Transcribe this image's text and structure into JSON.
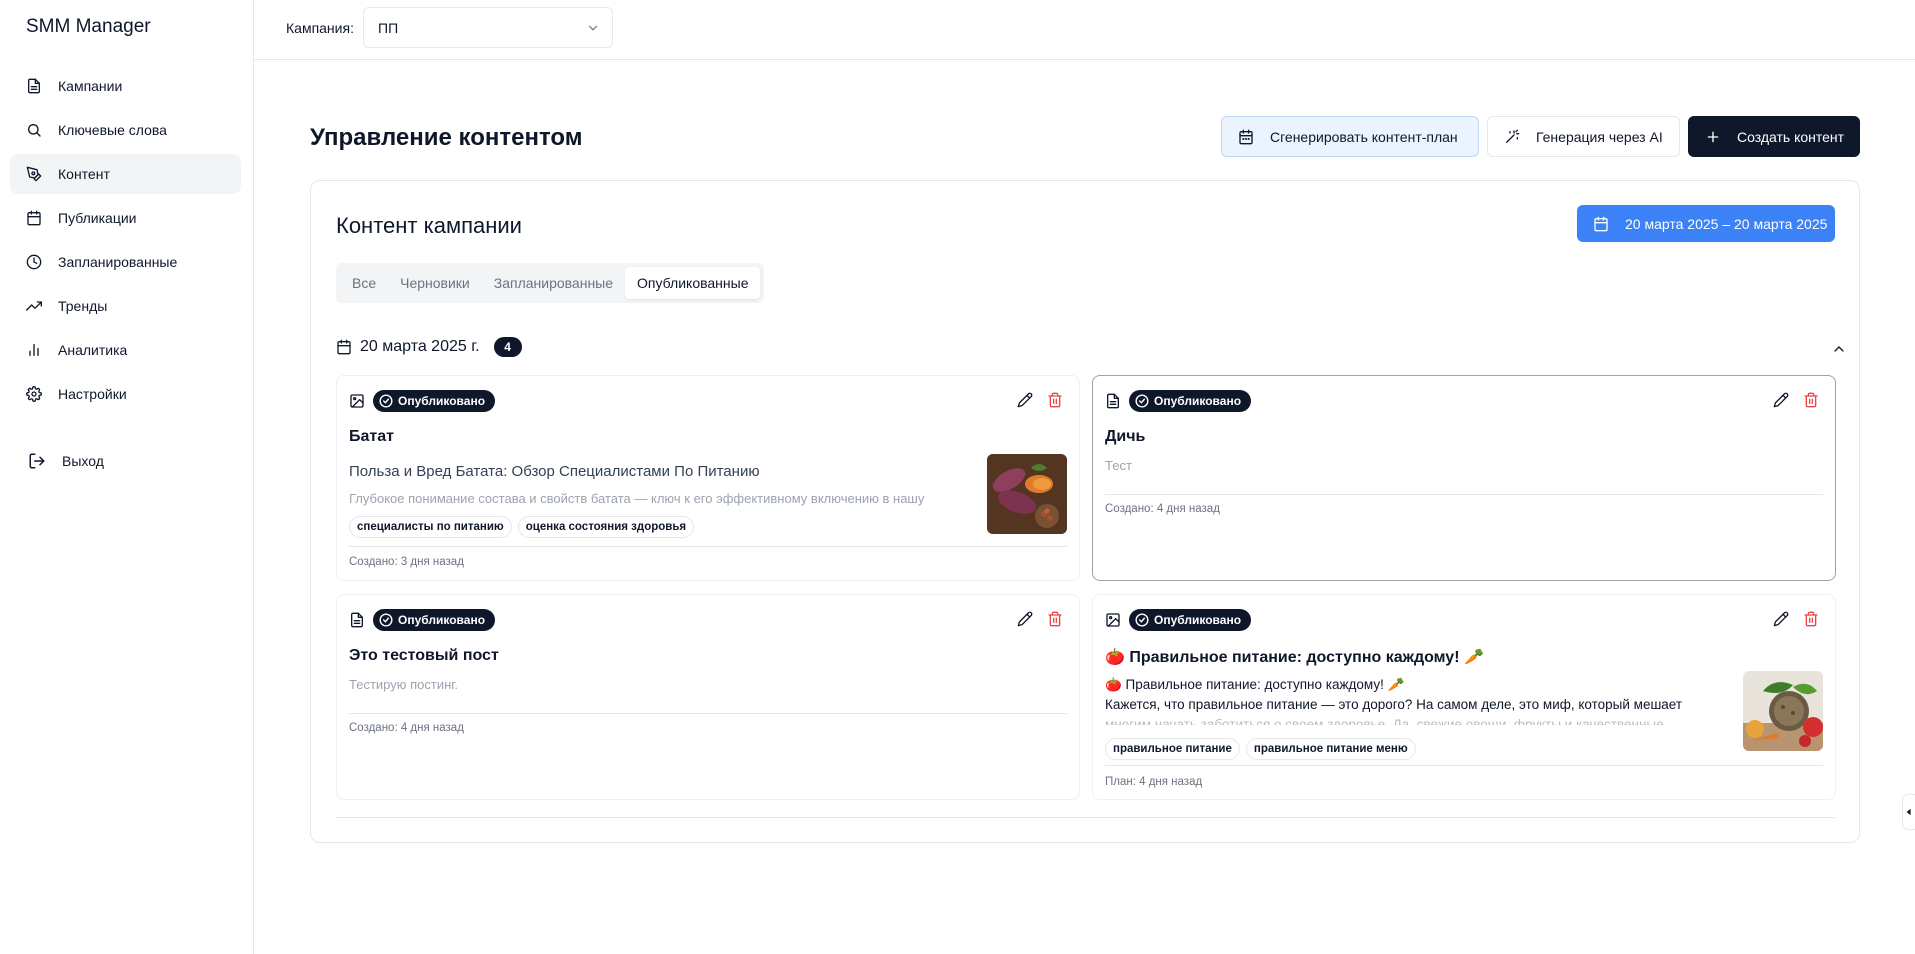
{
  "app": {
    "title": "SMM Manager"
  },
  "sidebar": {
    "items": [
      {
        "label": "Кампании",
        "icon": "file-text-icon"
      },
      {
        "label": "Ключевые слова",
        "icon": "search-icon"
      },
      {
        "label": "Контент",
        "icon": "pen-tool-icon",
        "active": true
      },
      {
        "label": "Публикации",
        "icon": "calendar-icon"
      },
      {
        "label": "Запланированные",
        "icon": "clock-icon"
      },
      {
        "label": "Тренды",
        "icon": "trending-up-icon"
      },
      {
        "label": "Аналитика",
        "icon": "bar-chart-icon"
      },
      {
        "label": "Настройки",
        "icon": "settings-icon"
      }
    ],
    "logout": "Выход"
  },
  "topbar": {
    "campaign_label": "Кампания:",
    "campaign_value": "ПП"
  },
  "header": {
    "title": "Управление контентом",
    "btn_plan": "Сгенерировать контент-план",
    "btn_ai": "Генерация через AI",
    "btn_create": "Создать контент"
  },
  "content": {
    "title": "Контент кампании",
    "date_range": "20 марта 2025 – 20 марта 2025",
    "tabs": [
      {
        "label": "Все"
      },
      {
        "label": "Черновики"
      },
      {
        "label": "Запланированные"
      },
      {
        "label": "Опубликованные",
        "active": true
      }
    ],
    "day": {
      "label": "20 марта 2025 г.",
      "count": "4"
    }
  },
  "posts": [
    {
      "type_icon": "image-icon",
      "status": "Опубликовано",
      "title": "Батат",
      "headline": "Польза и Вред Батата: Обзор Специалистами По Питанию",
      "text": "Глубокое понимание состава и свойств батата — ключ к его эффективному включению в нашу",
      "tags": [
        "специалисты по питанию",
        "оценка состояния здоровья"
      ],
      "meta": "Создано: 3 дня назад"
    },
    {
      "type_icon": "file-text-icon",
      "status": "Опубликовано",
      "title": "Дичь",
      "text": "Тест",
      "meta": "Создано: 4 дня назад"
    },
    {
      "type_icon": "file-text-icon",
      "status": "Опубликовано",
      "title": "Это тестовый пост",
      "text": "Тестирую постинг.",
      "meta": "Создано: 4 дня назад"
    },
    {
      "type_icon": "image-icon",
      "status": "Опубликовано",
      "title": "🍅 Правильное питание: доступно каждому! 🥕",
      "body_line1": "🍅 Правильное питание: доступно каждому! 🥕",
      "body_line2": "Кажется, что правильное питание — это дорого? На самом деле, это миф, который мешает",
      "body_line3": "многим начать заботиться о своем здоровье. Да, свежие овощи, фрукты и качественные",
      "tags": [
        "правильное питание",
        "правильное питание меню"
      ],
      "meta": "План: 4 дня назад"
    }
  ],
  "colors": {
    "primary": "#0f172a",
    "accent_blue": "#3b82f6",
    "danger": "#ef4444",
    "plan_btn_bg": "#eaf3fe"
  }
}
